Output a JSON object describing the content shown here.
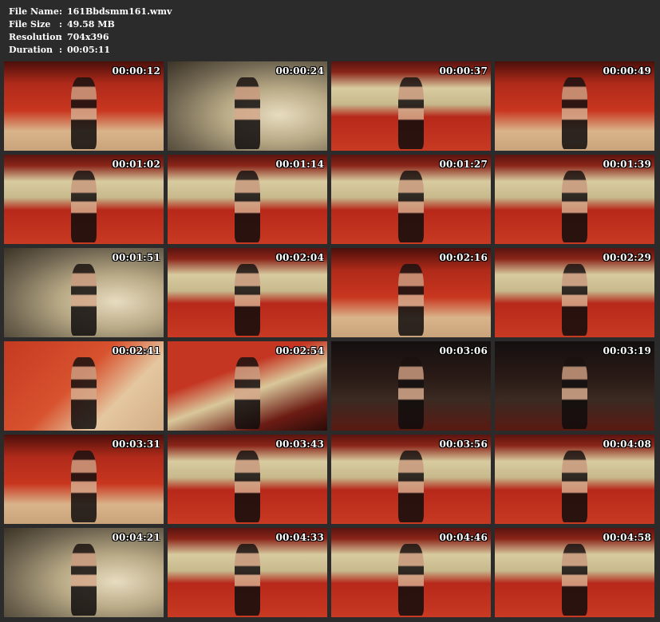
{
  "file_info": {
    "rows": [
      {
        "label": "File Name",
        "sep": ":",
        "value": "161Bbdsmm161.wmv"
      },
      {
        "label": "File Size",
        "sep": ":",
        "value": "49.58 MB"
      },
      {
        "label": "Resolution",
        "sep": ":",
        "value": "704x396"
      },
      {
        "label": "Duration",
        "sep": ":",
        "value": "00:05:11"
      }
    ]
  },
  "thumbnails": [
    {
      "time": "00:00:12",
      "scene": "red-curtain"
    },
    {
      "time": "00:00:24",
      "scene": "satin-close"
    },
    {
      "time": "00:00:37",
      "scene": "satin-red"
    },
    {
      "time": "00:00:49",
      "scene": "red-curtain"
    },
    {
      "time": "00:01:02",
      "scene": "satin-red"
    },
    {
      "time": "00:01:14",
      "scene": "satin-red"
    },
    {
      "time": "00:01:27",
      "scene": "satin-red"
    },
    {
      "time": "00:01:39",
      "scene": "satin-red"
    },
    {
      "time": "00:01:51",
      "scene": "satin-close"
    },
    {
      "time": "00:02:04",
      "scene": "satin-red"
    },
    {
      "time": "00:02:16",
      "scene": "red-curtain"
    },
    {
      "time": "00:02:29",
      "scene": "satin-red"
    },
    {
      "time": "00:02:41",
      "scene": "red-floor"
    },
    {
      "time": "00:02:54",
      "scene": "red-satin-diag"
    },
    {
      "time": "00:03:06",
      "scene": "dark"
    },
    {
      "time": "00:03:19",
      "scene": "dark"
    },
    {
      "time": "00:03:31",
      "scene": "red-curtain"
    },
    {
      "time": "00:03:43",
      "scene": "satin-red"
    },
    {
      "time": "00:03:56",
      "scene": "satin-red"
    },
    {
      "time": "00:04:08",
      "scene": "satin-red"
    },
    {
      "time": "00:04:21",
      "scene": "satin-close"
    },
    {
      "time": "00:04:33",
      "scene": "satin-red"
    },
    {
      "time": "00:04:46",
      "scene": "satin-red"
    },
    {
      "time": "00:04:58",
      "scene": "satin-red"
    }
  ]
}
